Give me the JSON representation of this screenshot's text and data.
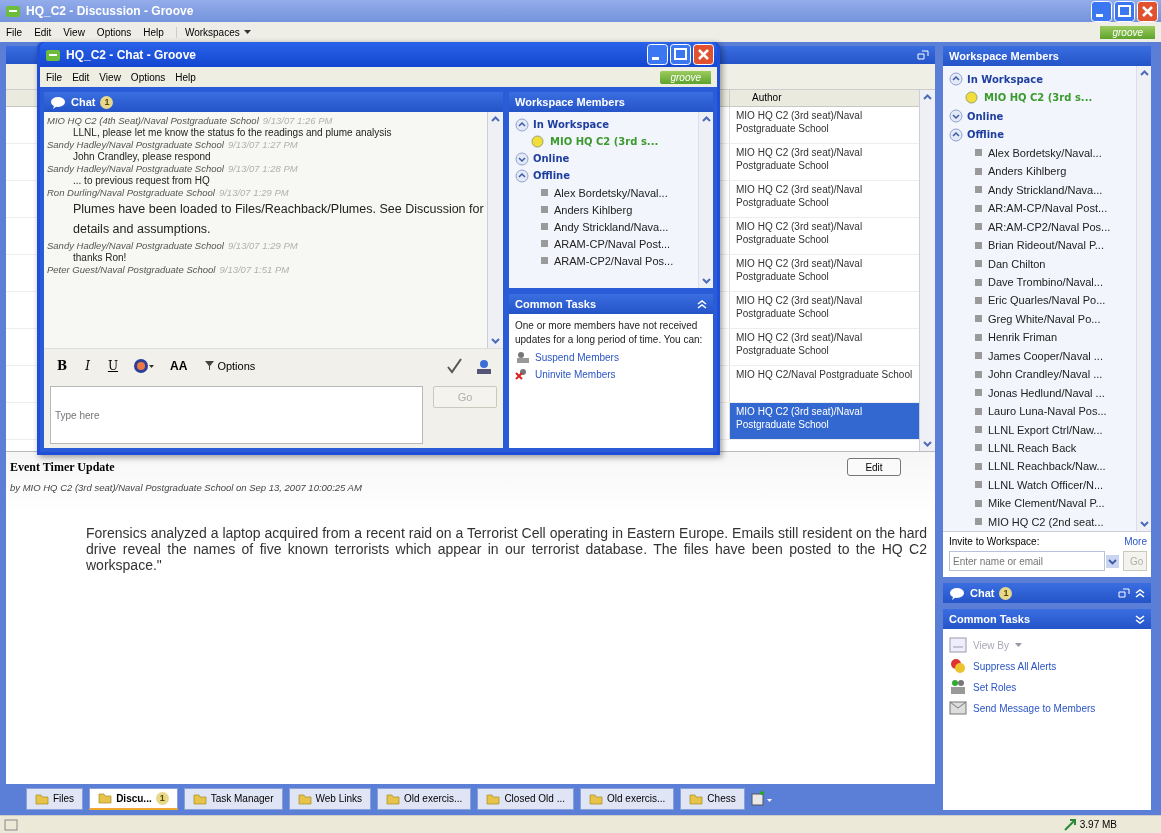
{
  "window": {
    "title": "HQ_C2 - Discussion - Groove"
  },
  "menu": [
    "File",
    "Edit",
    "View",
    "Options",
    "Help"
  ],
  "workspaces_menu": "Workspaces",
  "logo": "groove",
  "discussion": {
    "columns": [
      "Author"
    ],
    "rows": [
      {
        "author": "MIO HQ C2 (3rd seat)/Naval Postgraduate School",
        "selected": false
      },
      {
        "author": "MIO HQ C2 (3rd seat)/Naval Postgraduate School",
        "selected": false
      },
      {
        "author": "MIO HQ C2 (3rd seat)/Naval Postgraduate School",
        "selected": false
      },
      {
        "author": "MIO HQ C2 (3rd seat)/Naval Postgraduate School",
        "selected": false
      },
      {
        "author": "MIO HQ C2 (3rd seat)/Naval Postgraduate School",
        "selected": false
      },
      {
        "author": "MIO HQ C2 (3rd seat)/Naval Postgraduate School",
        "selected": false
      },
      {
        "author": "MIO HQ C2 (3rd seat)/Naval Postgraduate School",
        "selected": false
      },
      {
        "author": "MIO HQ C2/Naval Postgraduate School",
        "selected": false
      },
      {
        "author": "MIO HQ C2 (3rd seat)/Naval Postgraduate School",
        "selected": true
      }
    ]
  },
  "entry": {
    "title": "Event Timer Update",
    "byline": "by MIO HQ C2 (3rd seat)/Naval Postgraduate School on Sep 13, 2007 10:00:25 AM",
    "edit_button": "Edit",
    "body": "Forensics analyzed a laptop acquired from a recent raid on a Terrorist Cell operating in Eastern Europe. Emails still resident on the hard drive reveal the names of five known terrorists which appear in our terrorist database. The files have been posted to the HQ C2 workspace.\""
  },
  "tabs": [
    {
      "label": "Files",
      "selected": false
    },
    {
      "label": "Discu...",
      "selected": true,
      "badge": "1"
    },
    {
      "label": "Task Manager",
      "selected": false
    },
    {
      "label": "Web Links",
      "selected": false
    },
    {
      "label": "Old exercis...",
      "selected": false
    },
    {
      "label": "Closed Old ...",
      "selected": false
    },
    {
      "label": "Old exercis...",
      "selected": false
    },
    {
      "label": "Chess",
      "selected": false
    }
  ],
  "members_panel": {
    "title": "Workspace Members",
    "groups": [
      {
        "label": "In Workspace",
        "expanded": true,
        "members": [
          {
            "name": "MIO HQ C2 (3rd s...",
            "kind": "present"
          }
        ]
      },
      {
        "label": "Online",
        "expanded": false
      },
      {
        "label": "Offline",
        "expanded": true,
        "members": [
          {
            "name": "Alex Bordetsky/Naval...",
            "kind": "offline"
          },
          {
            "name": "Anders Kihlberg",
            "kind": "offline"
          },
          {
            "name": "Andy Strickland/Nava...",
            "kind": "offline"
          },
          {
            "name": "AR:AM-CP/Naval Post...",
            "kind": "offline"
          },
          {
            "name": "AR:AM-CP2/Naval Pos...",
            "kind": "offline"
          },
          {
            "name": "Brian Rideout/Naval P...",
            "kind": "offline"
          },
          {
            "name": "Dan Chilton",
            "kind": "offline"
          },
          {
            "name": "Dave Trombino/Naval...",
            "kind": "offline"
          },
          {
            "name": "Eric Quarles/Naval Po...",
            "kind": "offline"
          },
          {
            "name": "Greg White/Naval Po...",
            "kind": "offline"
          },
          {
            "name": "Henrik Friman",
            "kind": "offline"
          },
          {
            "name": "James Cooper/Naval ...",
            "kind": "offline"
          },
          {
            "name": "John Crandley/Naval ...",
            "kind": "offline"
          },
          {
            "name": "Jonas Hedlund/Naval ...",
            "kind": "offline"
          },
          {
            "name": "Lauro Luna-Naval Pos...",
            "kind": "offline"
          },
          {
            "name": "LLNL Export Ctrl/Naw...",
            "kind": "offline"
          },
          {
            "name": "LLNL Reach Back",
            "kind": "offline"
          },
          {
            "name": "LLNL Reachback/Naw...",
            "kind": "offline"
          },
          {
            "name": "LLNL Watch Officer/N...",
            "kind": "offline"
          },
          {
            "name": "Mike Clement/Naval P...",
            "kind": "offline"
          },
          {
            "name": "MIO HQ C2 (2nd seat...",
            "kind": "offline"
          }
        ]
      }
    ],
    "invite": {
      "label": "Invite to Workspace:",
      "more": "More",
      "placeholder": "Enter name or email",
      "go": "Go",
      "go_disabled": true
    }
  },
  "chat_bar": {
    "label": "Chat",
    "badge": "1"
  },
  "common_tasks": {
    "title": "Common Tasks",
    "items": [
      {
        "label": "View By",
        "kind": "menu",
        "disabled": true
      },
      {
        "label": "Suppress All Alerts",
        "kind": "alerts",
        "disabled": false
      },
      {
        "label": "Set Roles",
        "kind": "roles",
        "disabled": false
      },
      {
        "label": "Send Message to Members",
        "kind": "message",
        "disabled": false
      }
    ]
  },
  "status_bar": {
    "memory": "3.97 MB"
  },
  "chat_window": {
    "title": "HQ_C2 - Chat - Groove",
    "menu": [
      "File",
      "Edit",
      "View",
      "Options",
      "Help"
    ],
    "logo": "groove",
    "chat": {
      "title": "Chat",
      "badge": "1",
      "messages": [
        {
          "author": "MIO HQ C2 (4th Seat)/Naval Postgraduate School",
          "time": "9/13/07 1:26 PM",
          "text": "LLNL, please let me know the status fo the readings and plume analysis",
          "kind": "normal"
        },
        {
          "author": "Sandy Hadley/Naval Postgraduate School",
          "time": "9/13/07 1:27 PM",
          "text": "John Crandley, please respond",
          "kind": "normal"
        },
        {
          "author": "Sandy Hadley/Naval Postgraduate School",
          "time": "9/13/07 1:28 PM",
          "text": "... to previous request from HQ",
          "kind": "normal"
        },
        {
          "author": "Ron Durling/Naval Postgraduate School",
          "time": "9/13/07 1:29 PM",
          "text": "Plumes have been loaded to Files/Reachback/Plumes. See Discussion for details and assumptions.",
          "kind": "large"
        },
        {
          "author": "Sandy Hadley/Naval Postgraduate School",
          "time": "9/13/07 1:29 PM",
          "text": "thanks Ron!",
          "kind": "normal"
        },
        {
          "author": "Peter Guest/Naval Postgraduate School",
          "time": "9/13/07 1:51 PM"
        }
      ],
      "format_buttons": [
        "B",
        "I",
        "U"
      ],
      "size_button": "AA",
      "options": "Options",
      "placeholder": "Type here",
      "send": "Go",
      "send_disabled": true
    },
    "members": {
      "title": "Workspace Members",
      "groups": [
        {
          "label": "In Workspace",
          "expanded": true,
          "members": [
            {
              "name": "MIO HQ C2 (3rd s...",
              "kind": "present"
            }
          ]
        },
        {
          "label": "Online",
          "expanded": false
        },
        {
          "label": "Offline",
          "expanded": true,
          "members": [
            {
              "name": "Alex Bordetsky/Naval...",
              "kind": "offline"
            },
            {
              "name": "Anders Kihlberg",
              "kind": "offline"
            },
            {
              "name": "Andy Strickland/Nava...",
              "kind": "offline"
            },
            {
              "name": "ARAM-CP/Naval Post...",
              "kind": "offline"
            },
            {
              "name": "ARAM-CP2/Naval Pos...",
              "kind": "offline"
            }
          ]
        }
      ]
    },
    "common_tasks": {
      "title": "Common Tasks",
      "message": "One or more members have not received updates for a long period of time. You can:",
      "links": [
        "Suspend Members",
        "Uninvite Members"
      ]
    }
  }
}
